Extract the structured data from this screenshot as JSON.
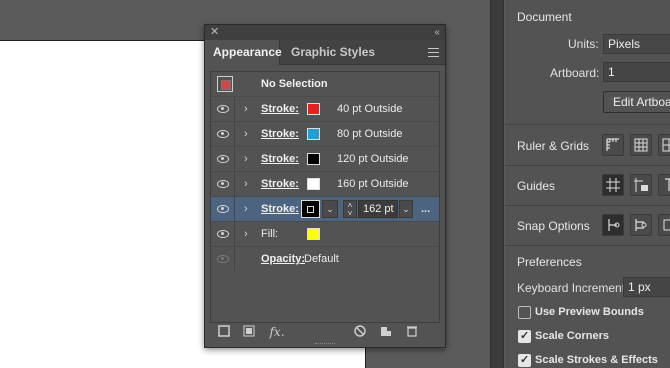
{
  "appearance_panel": {
    "tabs": [
      "Appearance",
      "Graphic Styles"
    ],
    "no_selection": "No Selection",
    "strokes": [
      {
        "label": "Stroke:",
        "color": "#e52222",
        "value": "40 pt  Outside"
      },
      {
        "label": "Stroke:",
        "color": "#1f9fd6",
        "value": "80 pt  Outside"
      },
      {
        "label": "Stroke:",
        "color": "#000000",
        "value": "120 pt  Outside"
      },
      {
        "label": "Stroke:",
        "color": "#ffffff",
        "value": "160 pt  Outside"
      }
    ],
    "selected_stroke": {
      "label": "Stroke:",
      "weight": "162 pt",
      "more": "..."
    },
    "fill": {
      "label": "Fill:",
      "color": "#ffff00"
    },
    "opacity": {
      "label": "Opacity:",
      "value": "Default"
    },
    "footer_icons": [
      "add-stroke-icon",
      "add-fill-icon",
      "fx-icon",
      "clear-appearance-icon",
      "duplicate-item-icon",
      "delete-item-icon"
    ],
    "fx_label": "fx."
  },
  "properties_panel": {
    "document_title": "Document",
    "units_label": "Units:",
    "units_value": "Pixels",
    "artboard_label": "Artboard:",
    "artboard_value": "1",
    "edit_artboards_button": "Edit Artboards",
    "ruler_grids_title": "Ruler & Grids",
    "guides_title": "Guides",
    "snap_options_title": "Snap Options",
    "preferences_title": "Preferences",
    "keyboard_increment_label": "Keyboard Increment:",
    "keyboard_increment_value": "1 px",
    "use_preview_bounds": "Use Preview Bounds",
    "use_preview_bounds_checked": false,
    "scale_corners": "Scale Corners",
    "scale_corners_checked": true,
    "scale_strokes_effects": "Scale Strokes & Effects",
    "scale_strokes_effects_checked": true
  }
}
